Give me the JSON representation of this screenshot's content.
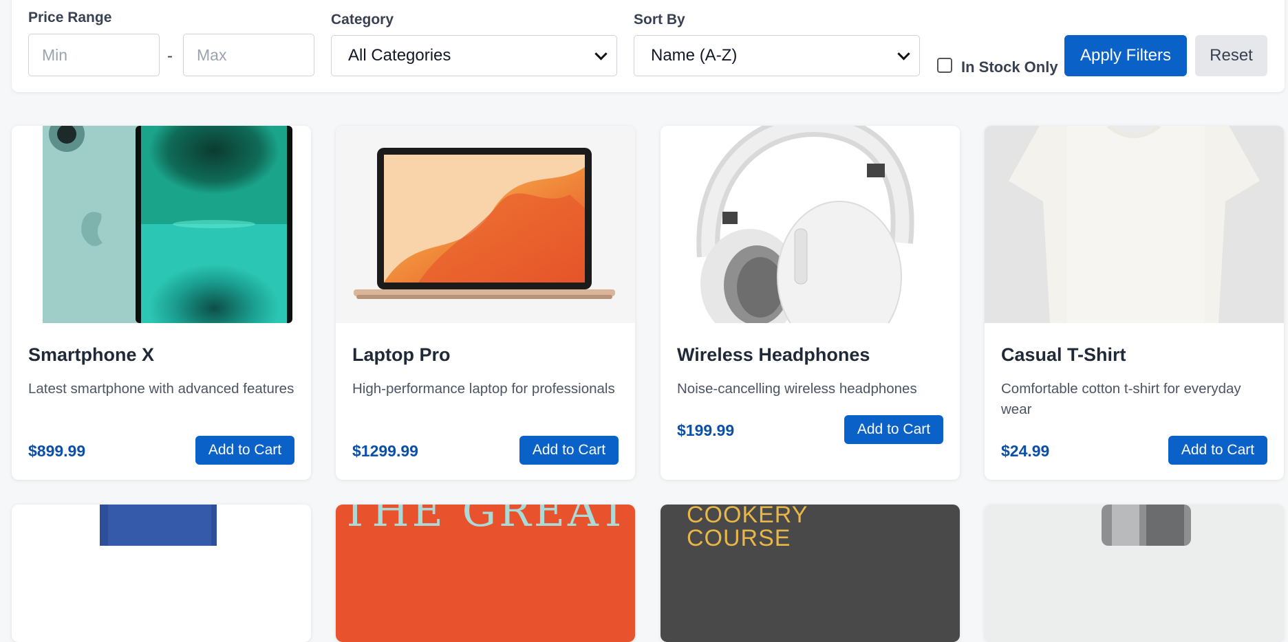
{
  "filters": {
    "price_range_label": "Price Range",
    "min_placeholder": "Min",
    "max_placeholder": "Max",
    "dash": "-",
    "category_label": "Category",
    "category_value": "All Categories",
    "sort_label": "Sort By",
    "sort_value": "Name (A-Z)",
    "in_stock_label": "In Stock Only",
    "in_stock_checked": false,
    "apply_label": "Apply Filters",
    "reset_label": "Reset"
  },
  "products": [
    {
      "name": "Smartphone X",
      "description": "Latest smartphone with advanced features",
      "price": "$899.99",
      "button": "Add to Cart",
      "image": "smartphone-image"
    },
    {
      "name": "Laptop Pro",
      "description": "High-performance laptop for professionals",
      "price": "$1299.99",
      "button": "Add to Cart",
      "image": "laptop-image"
    },
    {
      "name": "Wireless Headphones",
      "description": "Noise-cancelling wireless headphones",
      "price": "$199.99",
      "button": "Add to Cart",
      "image": "headphones-image"
    },
    {
      "name": "Casual T-Shirt",
      "description": "Comfortable cotton t-shirt for everyday wear",
      "price": "$24.99",
      "button": "Add to Cart",
      "image": "tshirt-image"
    }
  ],
  "second_row_images": [
    "jeans-image",
    "book-cover-image",
    "cookbook-cover-image",
    "appliance-image"
  ],
  "second_row_texts": {
    "book_cover_text": "THE GREAT",
    "cookbook_text": "COOKERY COURSE"
  },
  "colors": {
    "primary": "#0a62c9",
    "price": "#0a4fa8",
    "reset_bg": "#e5e7eb",
    "background": "#f6f7f9"
  }
}
